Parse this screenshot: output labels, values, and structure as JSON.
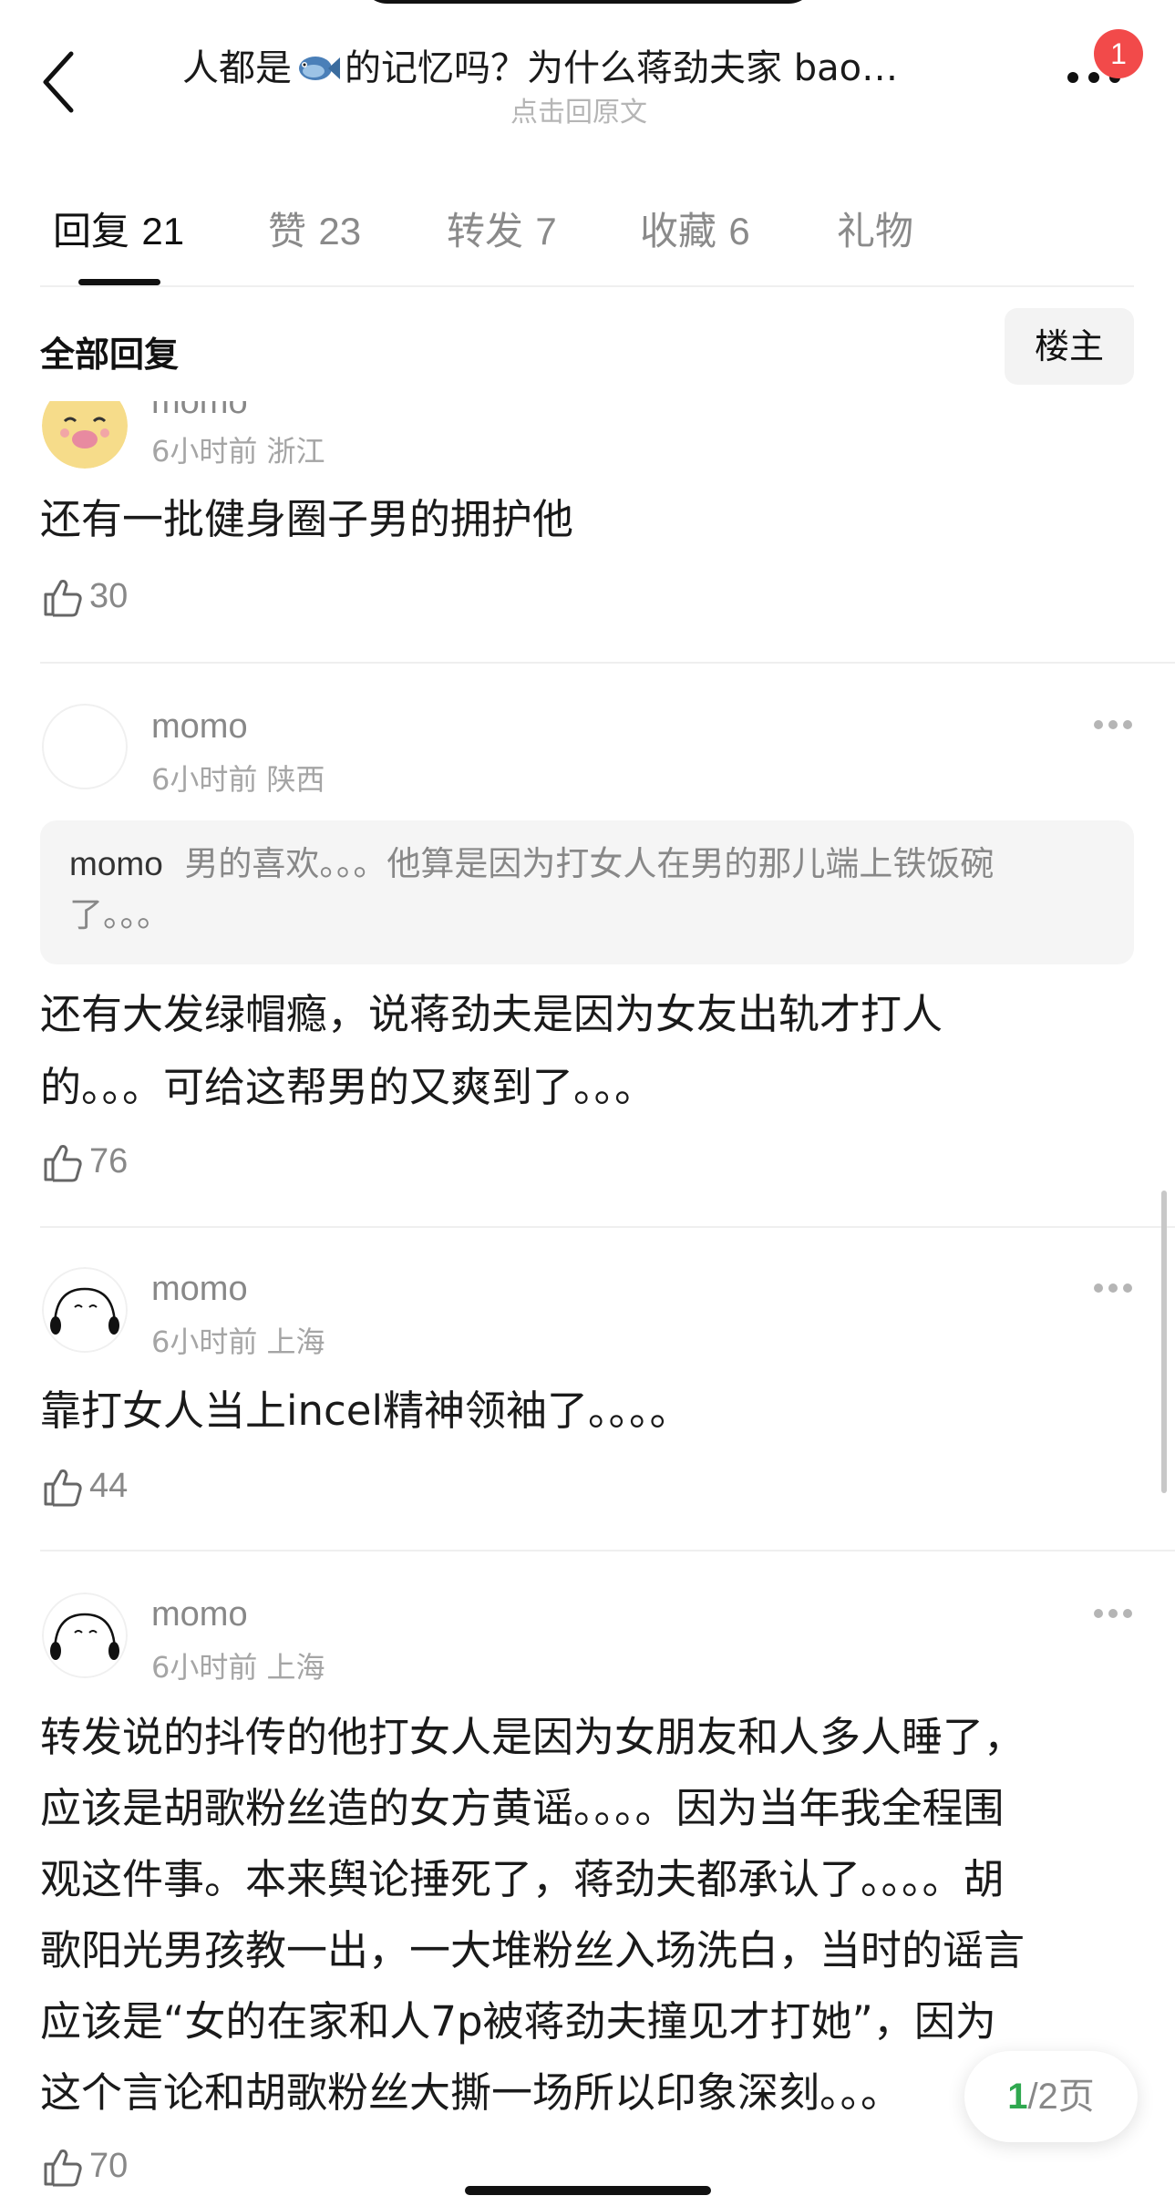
{
  "header": {
    "title_before": "人都是",
    "title_after": "的记忆吗？为什么蒋劲夫家 bao…",
    "subtitle": "点击回原文",
    "notification_count": "1"
  },
  "tabs": [
    {
      "label": "回复",
      "count": "21",
      "active": true
    },
    {
      "label": "赞",
      "count": "23"
    },
    {
      "label": "转发",
      "count": "7"
    },
    {
      "label": "收藏",
      "count": "6"
    },
    {
      "label": "礼物",
      "count": ""
    }
  ],
  "section": {
    "title": "全部回复",
    "filter_button": "楼主"
  },
  "comments": [
    {
      "username": "momo",
      "time": "6小时前",
      "location": "浙江",
      "text": "还有一批健身圈子男的拥护他",
      "likes": "30",
      "avatar": "cartoon-face"
    },
    {
      "username": "momo",
      "time": "6小时前",
      "location": "陕西",
      "quote_user": "momo",
      "quote_text_line1": "男的喜欢。。。他算是因为打女人在男的那儿端上铁饭碗",
      "quote_text_line2": "了。。。",
      "text_line1": "还有大发绿帽瘾，说蒋劲夫是因为女友出轨才打人",
      "text_line2": "的。。。可给这帮男的又爽到了。。。",
      "likes": "76",
      "avatar": "blank"
    },
    {
      "username": "momo",
      "time": "6小时前",
      "location": "上海",
      "text": "靠打女人当上incel精神领袖了。。。。",
      "likes": "44",
      "avatar": "sketch-face"
    },
    {
      "username": "momo",
      "time": "6小时前",
      "location": "上海",
      "text_lines": [
        "转发说的抖传的他打女人是因为女朋友和人多人睡了，",
        "应该是胡歌粉丝造的女方黄谣。。。。因为当年我全程围",
        "观这件事。本来舆论捶死了，蒋劲夫都承认了。。。。胡",
        "歌阳光男孩教一出，一大堆粉丝入场洗白，当时的谣言",
        "应该是“女的在家和人7p被蒋劲夫撞见才打她”，因为",
        "这个言论和胡歌粉丝大撕一场所以印象深刻。。。"
      ],
      "likes": "70",
      "avatar": "sketch-face"
    }
  ],
  "pager": {
    "current": "1",
    "total_text": "/2页"
  },
  "colors": {
    "accent_green": "#2fa84f",
    "badge_red": "#f24a4a"
  }
}
